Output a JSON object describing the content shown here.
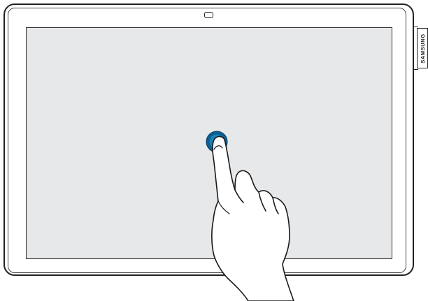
{
  "device": {
    "brand_label": "SAMSUNG"
  },
  "screen": {
    "content": ""
  },
  "gesture": {
    "type": "tap",
    "touch_color": "#0a5f94",
    "icon": "hand-pointer-icon"
  },
  "colors": {
    "screen_bg": "#e6e8ea",
    "outline": "#222222"
  }
}
